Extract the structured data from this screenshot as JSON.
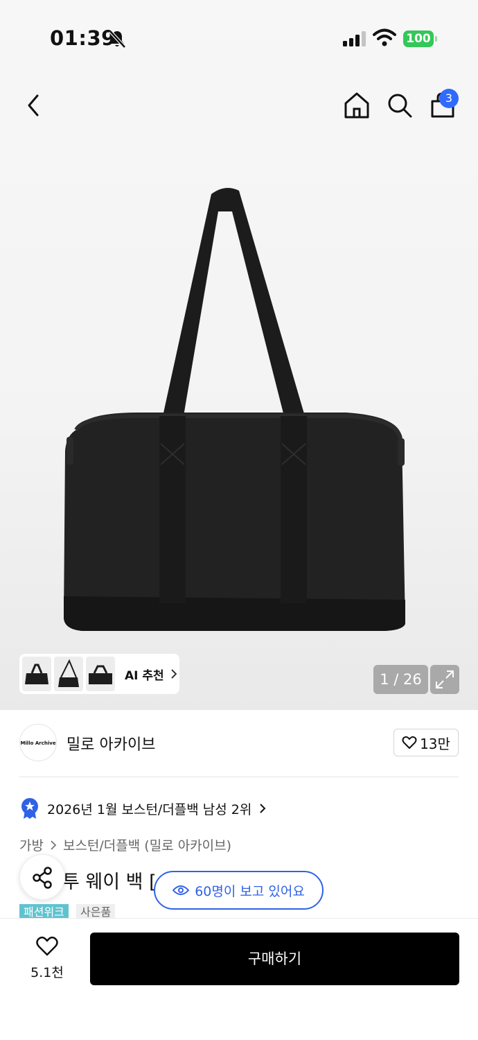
{
  "status_bar": {
    "time": "01:39",
    "battery": "100"
  },
  "nav": {
    "cart_count": "3"
  },
  "gallery": {
    "pager": "1 / 26",
    "ai_label": "AI 추천"
  },
  "brand": {
    "logo_text": "Millo Archive",
    "name": "밀로 아카이브",
    "likes": "13만"
  },
  "ranking": {
    "text": "2026년 1월 보스턴/더플백 남성 2위"
  },
  "breadcrumb": {
    "level1": "가방",
    "level2": "보스턴/더플백 (밀로 아카이브)"
  },
  "product": {
    "title_visible": "투 웨이 백 ["
  },
  "viewers": {
    "text": "60명이 보고 있어요"
  },
  "tags": {
    "tag1": "패션위크",
    "tag2": "사은품"
  },
  "bottom": {
    "wish_count": "5.1천",
    "buy_label": "구매하기"
  },
  "colors": {
    "accent_blue": "#2f62e6",
    "badge_blue": "#2f6bff",
    "battery_green": "#34c759",
    "tag_teal": "#5fc3cf",
    "buy_black": "#000000"
  }
}
